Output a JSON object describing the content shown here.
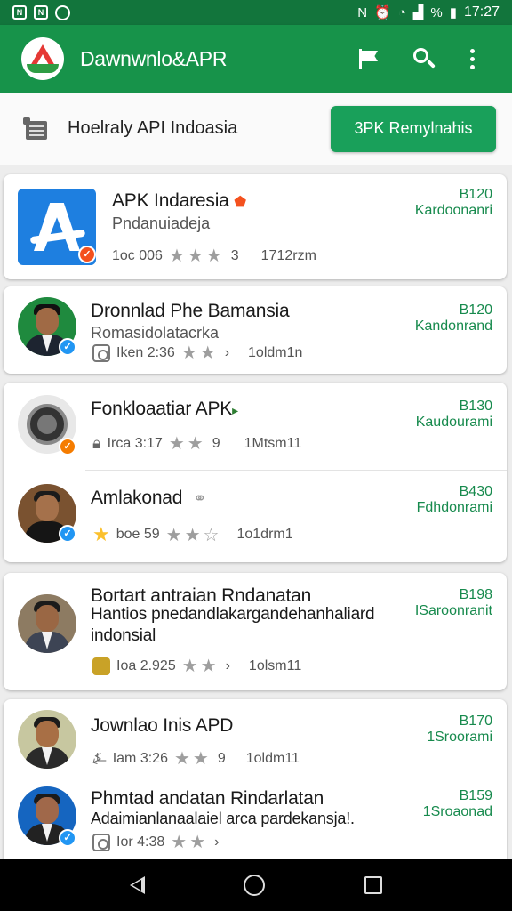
{
  "status_bar": {
    "left_icons": [
      "notification-icon",
      "notification-icon",
      "circle-icon"
    ],
    "time": "17:27",
    "battery_percent": "%"
  },
  "app_bar": {
    "title": "Dawnwnlo&APR",
    "actions": [
      "flag-icon",
      "search-icon",
      "more-vert-icon"
    ]
  },
  "filter": {
    "text": "Hoelraly API Indoasia",
    "cta_label": "3PK Remylnahis"
  },
  "apps": [
    {
      "title": "APK Indaresia",
      "subtitle": "Pndanuiadeja",
      "meta": "1oc 006",
      "count": "3",
      "downloads": "1712rzm",
      "price": "B120",
      "price_label": "Kardoonanri"
    },
    {
      "title": "Dronnlad Phe Bamansia",
      "subtitle": "Romasidolatacrka",
      "meta": "Iken 2:36",
      "count": "",
      "downloads": "1oldm1n",
      "price": "B120",
      "price_label": "Kandonrand"
    },
    {
      "title": "Fonkloaatiar APK",
      "subtitle": "",
      "meta": "Irca 3:17",
      "count": "9",
      "downloads": "1Mtsm11",
      "price": "B130",
      "price_label": "Kaudourami"
    },
    {
      "title": "Amlakonad",
      "subtitle": "",
      "meta": "boe 59",
      "count": "",
      "downloads": "1o1drm1",
      "price": "B430",
      "price_label": "Fdhdonrami"
    },
    {
      "title": "Bortart antraian Rndanatan",
      "subtitle": "Hantios pnedandlakargandehanhaliard",
      "subtitle2": "indonsial",
      "meta": "Ioa 2.925",
      "count": "",
      "downloads": "1olsm11",
      "price": "B198",
      "price_label": "ISaroonranit"
    },
    {
      "title": "Jownlao Inis APD",
      "subtitle": "",
      "meta": "Iam 3:26",
      "count": "9",
      "downloads": "1oldm11",
      "price": "B170",
      "price_label": "1Sroorami"
    },
    {
      "title": "Phmtad andatan Rindarlatan",
      "subtitle": "Adaimianlanaalaiel arca pardekansja!.",
      "meta": "Ior 4:38",
      "count": "",
      "downloads": "",
      "price": "B159",
      "price_label": "1Sroaonad"
    }
  ],
  "colors": {
    "status_bar": "#12753c",
    "app_bar": "#17934a",
    "accent_button": "#19a05a",
    "price_text": "#178a4d"
  }
}
